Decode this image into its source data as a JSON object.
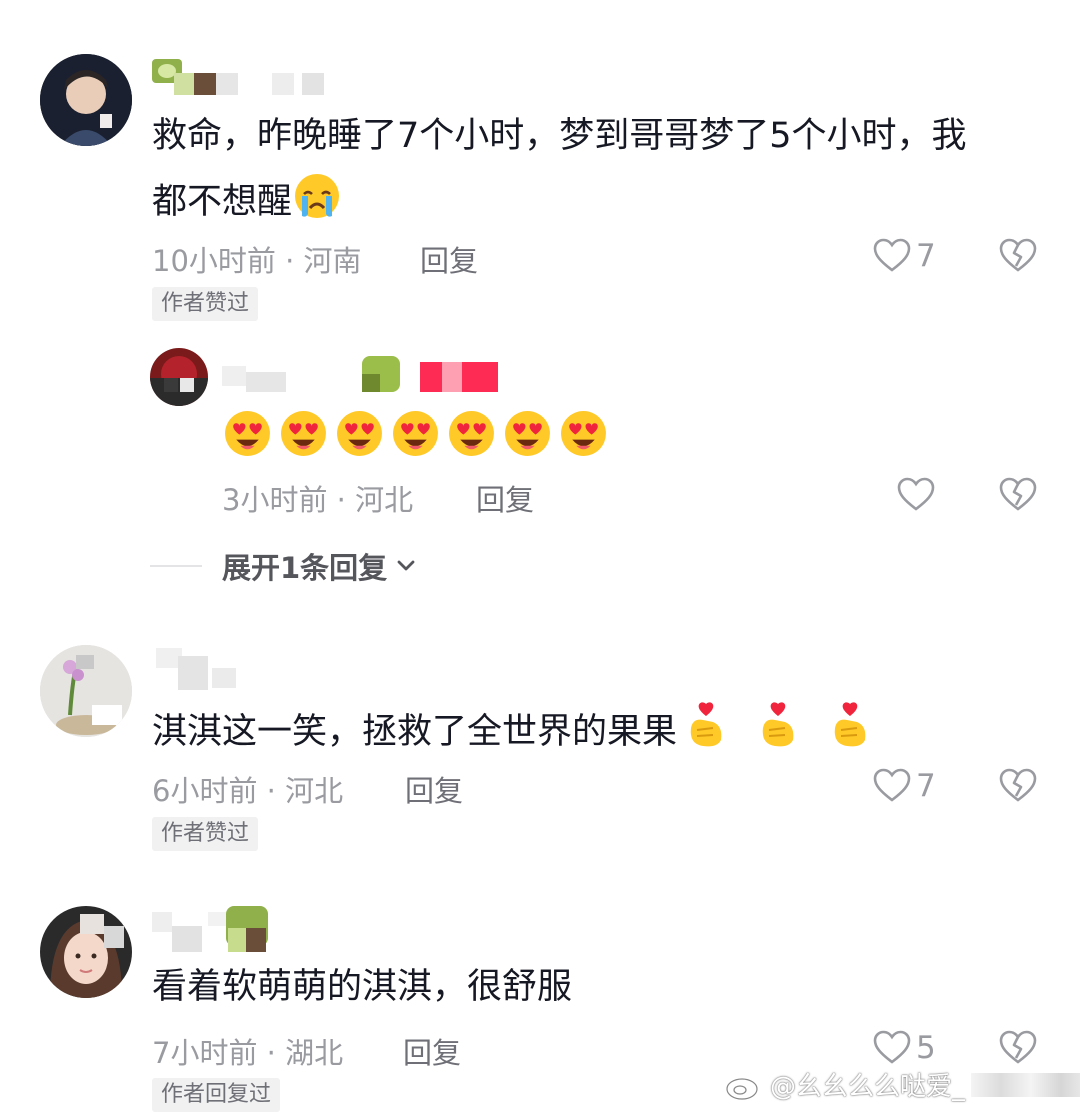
{
  "comments": [
    {
      "text_line1": "救命，昨晚睡了7个小时，梦到哥哥梦了5个小时，我",
      "text_line2": "都不想醒",
      "time": "10小时前 · 河南",
      "reply_label": "回复",
      "like_count": "7",
      "tag": "作者赞过",
      "reply": {
        "time": "3小时前 · 河北",
        "reply_label": "回复",
        "emoji_count": 7
      },
      "expand_label": "展开1条回复"
    },
    {
      "text": "淇淇这一笑，拯救了全世界的果果",
      "time": "6小时前 · 河北",
      "reply_label": "回复",
      "like_count": "7",
      "tag": "作者赞过"
    },
    {
      "text": "看着软萌萌的淇淇，很舒服",
      "time": "7小时前 · 湖北",
      "reply_label": "回复",
      "like_count": "5",
      "tag": "作者回复过"
    }
  ],
  "watermark": {
    "text": "@幺幺么么哒爱_"
  },
  "colors": {
    "text": "#161823",
    "meta": "#9a9ba1",
    "tag_bg": "#f1f1f2",
    "brand_pink": "#fe2c55"
  }
}
